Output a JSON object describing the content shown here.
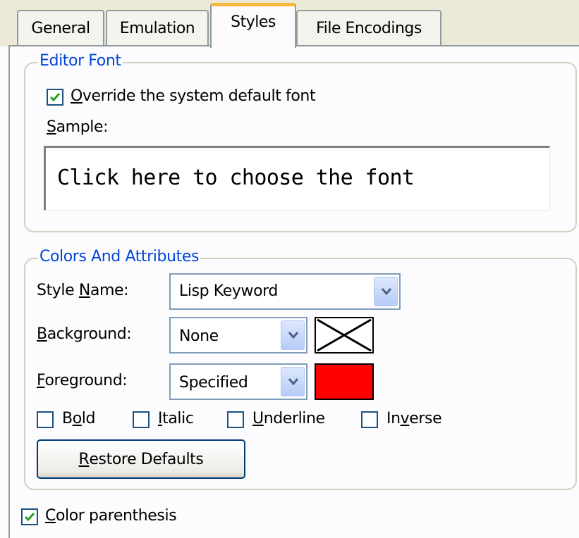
{
  "tabs": [
    {
      "label": "General"
    },
    {
      "label": "Emulation"
    },
    {
      "label": "Styles",
      "active": true
    },
    {
      "label": "File Encodings"
    }
  ],
  "editor_font": {
    "legend": "Editor Font",
    "override_checkbox": {
      "prefix_u": "O",
      "rest": "verride the system default font",
      "checked": true
    },
    "sample_label": {
      "prefix_u": "S",
      "rest": "ample:"
    },
    "sample_text": "Click here to choose the font"
  },
  "colors": {
    "legend": "Colors And Attributes",
    "style_name": {
      "pre": "Style ",
      "u": "N",
      "post": "ame:",
      "value": "Lisp Keyword"
    },
    "background": {
      "u": "B",
      "post": "ackground:",
      "value": "None",
      "swatch": "none"
    },
    "foreground": {
      "u": "F",
      "post": "oreground:",
      "value": "Specified",
      "swatch_color": "#ff0000"
    },
    "attributes": [
      {
        "pre": "B",
        "u": "o",
        "post": "ld",
        "checked": false
      },
      {
        "pre": "",
        "u": "I",
        "post": "talic",
        "checked": false
      },
      {
        "pre": "",
        "u": "U",
        "post": "nderline",
        "checked": false
      },
      {
        "pre": "In",
        "u": "v",
        "post": "erse",
        "checked": false
      }
    ],
    "restore_button": {
      "u": "R",
      "post": "estore Defaults"
    }
  },
  "color_parenthesis": {
    "u": "C",
    "post": "olor parenthesis",
    "checked": true
  },
  "theme": {
    "accent": "#0046d5",
    "tab_highlight": "#f6b83a",
    "check_green": "#21a121"
  }
}
